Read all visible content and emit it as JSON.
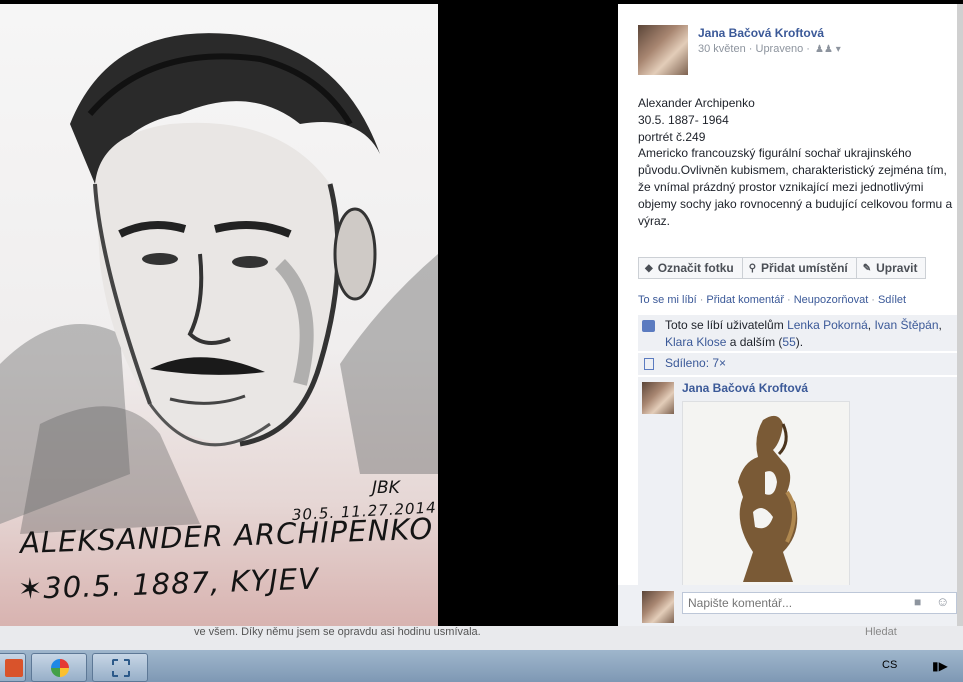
{
  "drawing": {
    "caption_line1": "ALEKSANDER ARCHIPENKO",
    "caption_line2": "✶30.5. 1887, KYJEV",
    "signature": "JBK",
    "date": "30.5. 11.27.2014"
  },
  "post": {
    "author": "Jana Bačová Kroftová",
    "date": "30 květen",
    "edited": "Upraveno",
    "meta_sep": "·",
    "audience_icon": "friends-icon",
    "text": [
      "Alexander Archipenko",
      "30.5. 1887- 1964",
      "portrét č.249",
      "Americko francouzský figurální sochař ukrajinského původu.Ovlivněn kubismem, charakteristický zejména tím, že vnímal prázdný prostor vznikající mezi jednotlivými objemy sochy jako rovnocenný a budující celkovou formu a výraz."
    ]
  },
  "actions": {
    "tag": "Označit fotku",
    "location": "Přidat umístění",
    "edit": "Upravit"
  },
  "links": {
    "like": "To se mi líbí",
    "comment": "Přidat komentář",
    "notify": "Neupozorňovat",
    "share": "Sdílet",
    "sep": "·"
  },
  "likes": {
    "prefix": "Toto se líbí uživatelům ",
    "user1": "Lenka Pokorná",
    "comma1": ", ",
    "user2": "Ivan Štěpán",
    "comma2": ", ",
    "user3": "Klara Klose",
    "middle": " a dalším (",
    "count": "55",
    "suffix": ")."
  },
  "shares": {
    "label": "Sdíleno: 7×"
  },
  "comment": {
    "author": "Jana Bačová Kroftová"
  },
  "comment_input": {
    "placeholder": "Napište komentář..."
  },
  "background_page": {
    "text": "ve všem. Díky němu jsem se opravdu asi hodinu usmívala.",
    "search": "Hledat"
  },
  "taskbar": {
    "language": "CS"
  },
  "colors": {
    "link": "#3b5998",
    "panel_bg": "#ffffff",
    "likes_bg": "#eef0f4",
    "taskbar": "#8aa4bf"
  }
}
